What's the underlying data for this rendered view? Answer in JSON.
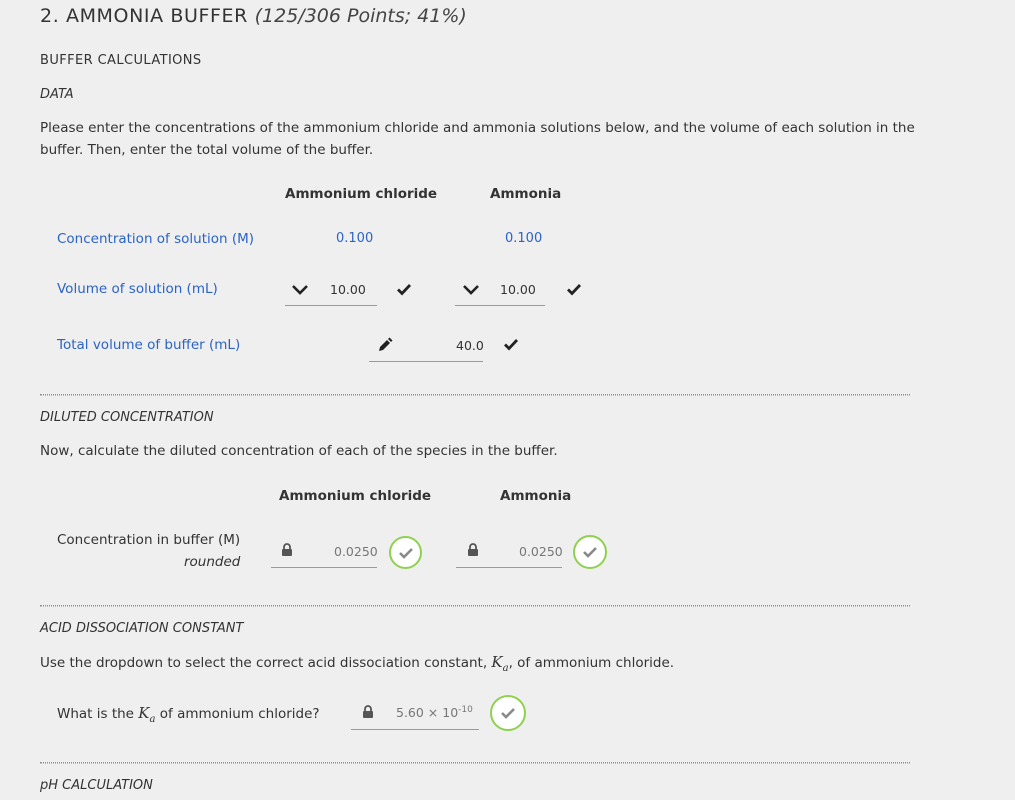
{
  "header": {
    "number_title": "2. AMMONIA BUFFER",
    "points": "(125/306 Points; 41%)"
  },
  "buffer_calc": {
    "heading": "BUFFER CALCULATIONS",
    "data_label": "DATA",
    "instructions": "Please enter the concentrations of the ammonium chloride and ammonia solutions below, and the volume of each solution in the buffer. Then, enter the total volume of the buffer.",
    "col_nh4cl": "Ammonium chloride",
    "col_nh3": "Ammonia",
    "row_concentration": "Concentration of solution (M)",
    "row_volume": "Volume of solution (mL)",
    "row_total": "Total volume of buffer (mL)",
    "conc_nh4cl": "0.100",
    "conc_nh3": "0.100",
    "vol_nh4cl": "10.00",
    "vol_nh3": "10.00",
    "total_volume": "40.0"
  },
  "diluted": {
    "heading": "DILUTED CONCENTRATION",
    "instructions": "Now, calculate the diluted concentration of each of the species in the buffer.",
    "col_nh4cl": "Ammonium chloride",
    "col_nh3": "Ammonia",
    "row_label": "Concentration in buffer (M)",
    "row_sublabel": "rounded",
    "value_nh4cl": "0.0250",
    "value_nh3": "0.0250"
  },
  "ka": {
    "heading": "ACID DISSOCIATION CONSTANT",
    "instr_before": "Use the dropdown to select the correct acid dissociation constant,",
    "instr_after": ", of ammonium chloride.",
    "question_before": "What is the",
    "question_after": "of ammonium chloride?",
    "ka_symbol": "K",
    "ka_sub": "a",
    "value_mantissa": "5.60 × 10",
    "value_exponent": "-10"
  },
  "ph": {
    "heading": "pH CALCULATION"
  },
  "colors": {
    "blue_label": "#2b63c6",
    "success_ring": "#8fd14f",
    "background": "#efefef"
  }
}
